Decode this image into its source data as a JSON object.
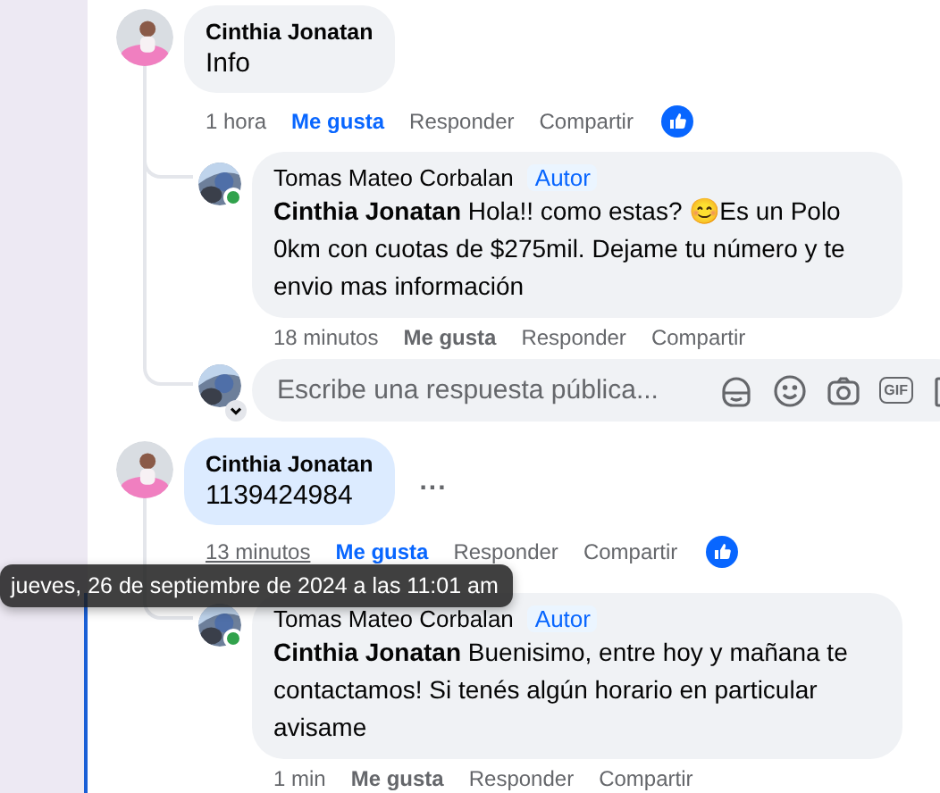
{
  "comments": [
    {
      "author": "Cinthia Jonatan",
      "text": "Info",
      "highlighted": false,
      "time": "1 hora",
      "time_hovered": false,
      "like_label": "Me gusta",
      "liked": true,
      "reply_label": "Responder",
      "share_label": "Compartir",
      "has_reactions": true,
      "replies": [
        {
          "author": "Tomas Mateo Corbalan",
          "badge": "Autor",
          "online": true,
          "text": "**Cinthia Jonatan** Hola!! como estas? 😊Es un Polo 0km con cuotas de $275mil. Dejame tu número y te envio mas información",
          "time": "18 minutos",
          "time_hovered": false,
          "like_label": "Me gusta",
          "liked": false,
          "reply_label": "Responder",
          "share_label": "Compartir"
        }
      ],
      "reply_box": {
        "placeholder": "Escribe una respuesta pública...",
        "gif_label": "GIF"
      }
    },
    {
      "author": "Cinthia Jonatan",
      "text": "1139424984",
      "highlighted": true,
      "more": "...",
      "time": "13 minutos",
      "time_hovered": true,
      "like_label": "Me gusta",
      "liked": true,
      "reply_label": "Responder",
      "share_label": "Compartir",
      "has_reactions": true,
      "replies": [
        {
          "author": "Tomas Mateo Corbalan",
          "badge": "Autor",
          "online": true,
          "text": "**Cinthia Jonatan** Buenisimo, entre hoy y mañana te contactamos! Si tenés algún horario en particular avisame",
          "time": "1 min",
          "time_hovered": false,
          "like_label": "Me gusta",
          "liked": false,
          "reply_label": "Responder",
          "share_label": "Compartir"
        }
      ]
    }
  ],
  "tooltip": "jueves, 26 de septiembre de 2024 a las 11:01 am"
}
